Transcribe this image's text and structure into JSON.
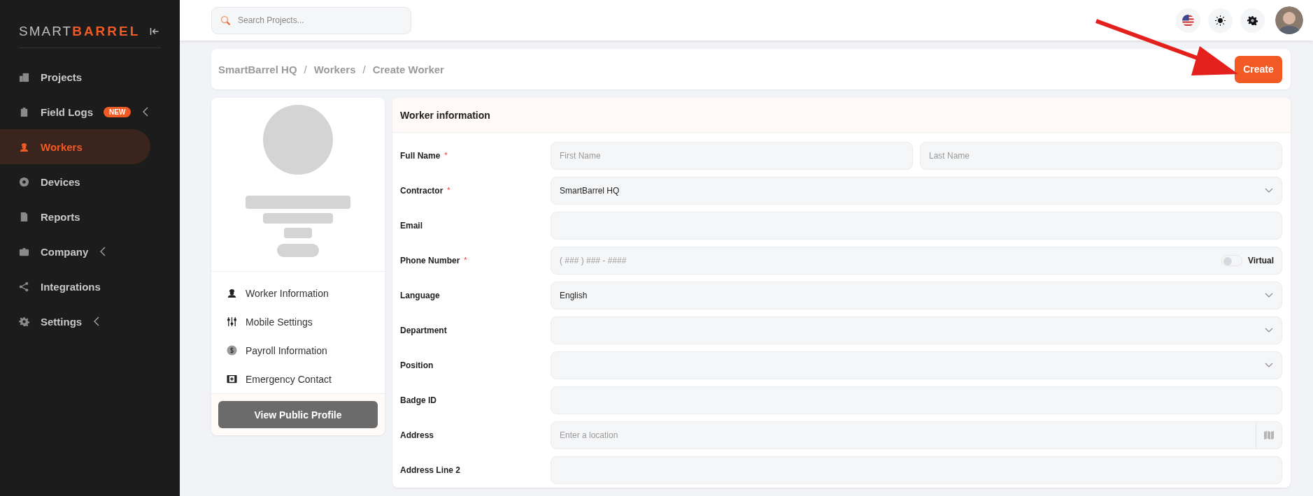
{
  "logo": {
    "light": "SMART",
    "bold": "BARREL"
  },
  "sidebar": {
    "items": [
      {
        "label": "Projects",
        "selected": false,
        "expandable": false
      },
      {
        "label": "Field Logs",
        "selected": false,
        "expandable": true,
        "badge": "NEW"
      },
      {
        "label": "Workers",
        "selected": true,
        "expandable": false
      },
      {
        "label": "Devices",
        "selected": false,
        "expandable": false
      },
      {
        "label": "Reports",
        "selected": false,
        "expandable": false
      },
      {
        "label": "Company",
        "selected": false,
        "expandable": true
      },
      {
        "label": "Integrations",
        "selected": false,
        "expandable": false
      },
      {
        "label": "Settings",
        "selected": false,
        "expandable": true
      }
    ]
  },
  "search": {
    "placeholder": "Search Projects..."
  },
  "breadcrumb": [
    "SmartBarrel HQ",
    "Workers",
    "Create Worker"
  ],
  "breadcrumb_separator": "/",
  "create_button": "Create",
  "profile_menu": [
    {
      "label": "Worker Information"
    },
    {
      "label": "Mobile Settings"
    },
    {
      "label": "Payroll Information"
    },
    {
      "label": "Emergency Contact"
    }
  ],
  "public_profile_button": "View Public Profile",
  "form": {
    "title": "Worker information",
    "required_mark": "*",
    "fields": [
      {
        "label": "Full Name",
        "required": true,
        "kind": "name",
        "placeholders": [
          "First Name",
          "Last Name"
        ]
      },
      {
        "label": "Contractor",
        "required": true,
        "kind": "select",
        "value": "SmartBarrel HQ"
      },
      {
        "label": "Email",
        "required": false,
        "kind": "text"
      },
      {
        "label": "Phone Number",
        "required": true,
        "kind": "phone",
        "placeholder": "( ### ) ### - ####",
        "toggle_label": "Virtual",
        "toggle_on": false
      },
      {
        "label": "Language",
        "required": false,
        "kind": "select",
        "value": "English"
      },
      {
        "label": "Department",
        "required": false,
        "kind": "select"
      },
      {
        "label": "Position",
        "required": false,
        "kind": "select"
      },
      {
        "label": "Badge ID",
        "required": false,
        "kind": "text"
      },
      {
        "label": "Address",
        "required": false,
        "kind": "address",
        "placeholder": "Enter a location"
      },
      {
        "label": "Address Line 2",
        "required": false,
        "kind": "text"
      }
    ]
  }
}
